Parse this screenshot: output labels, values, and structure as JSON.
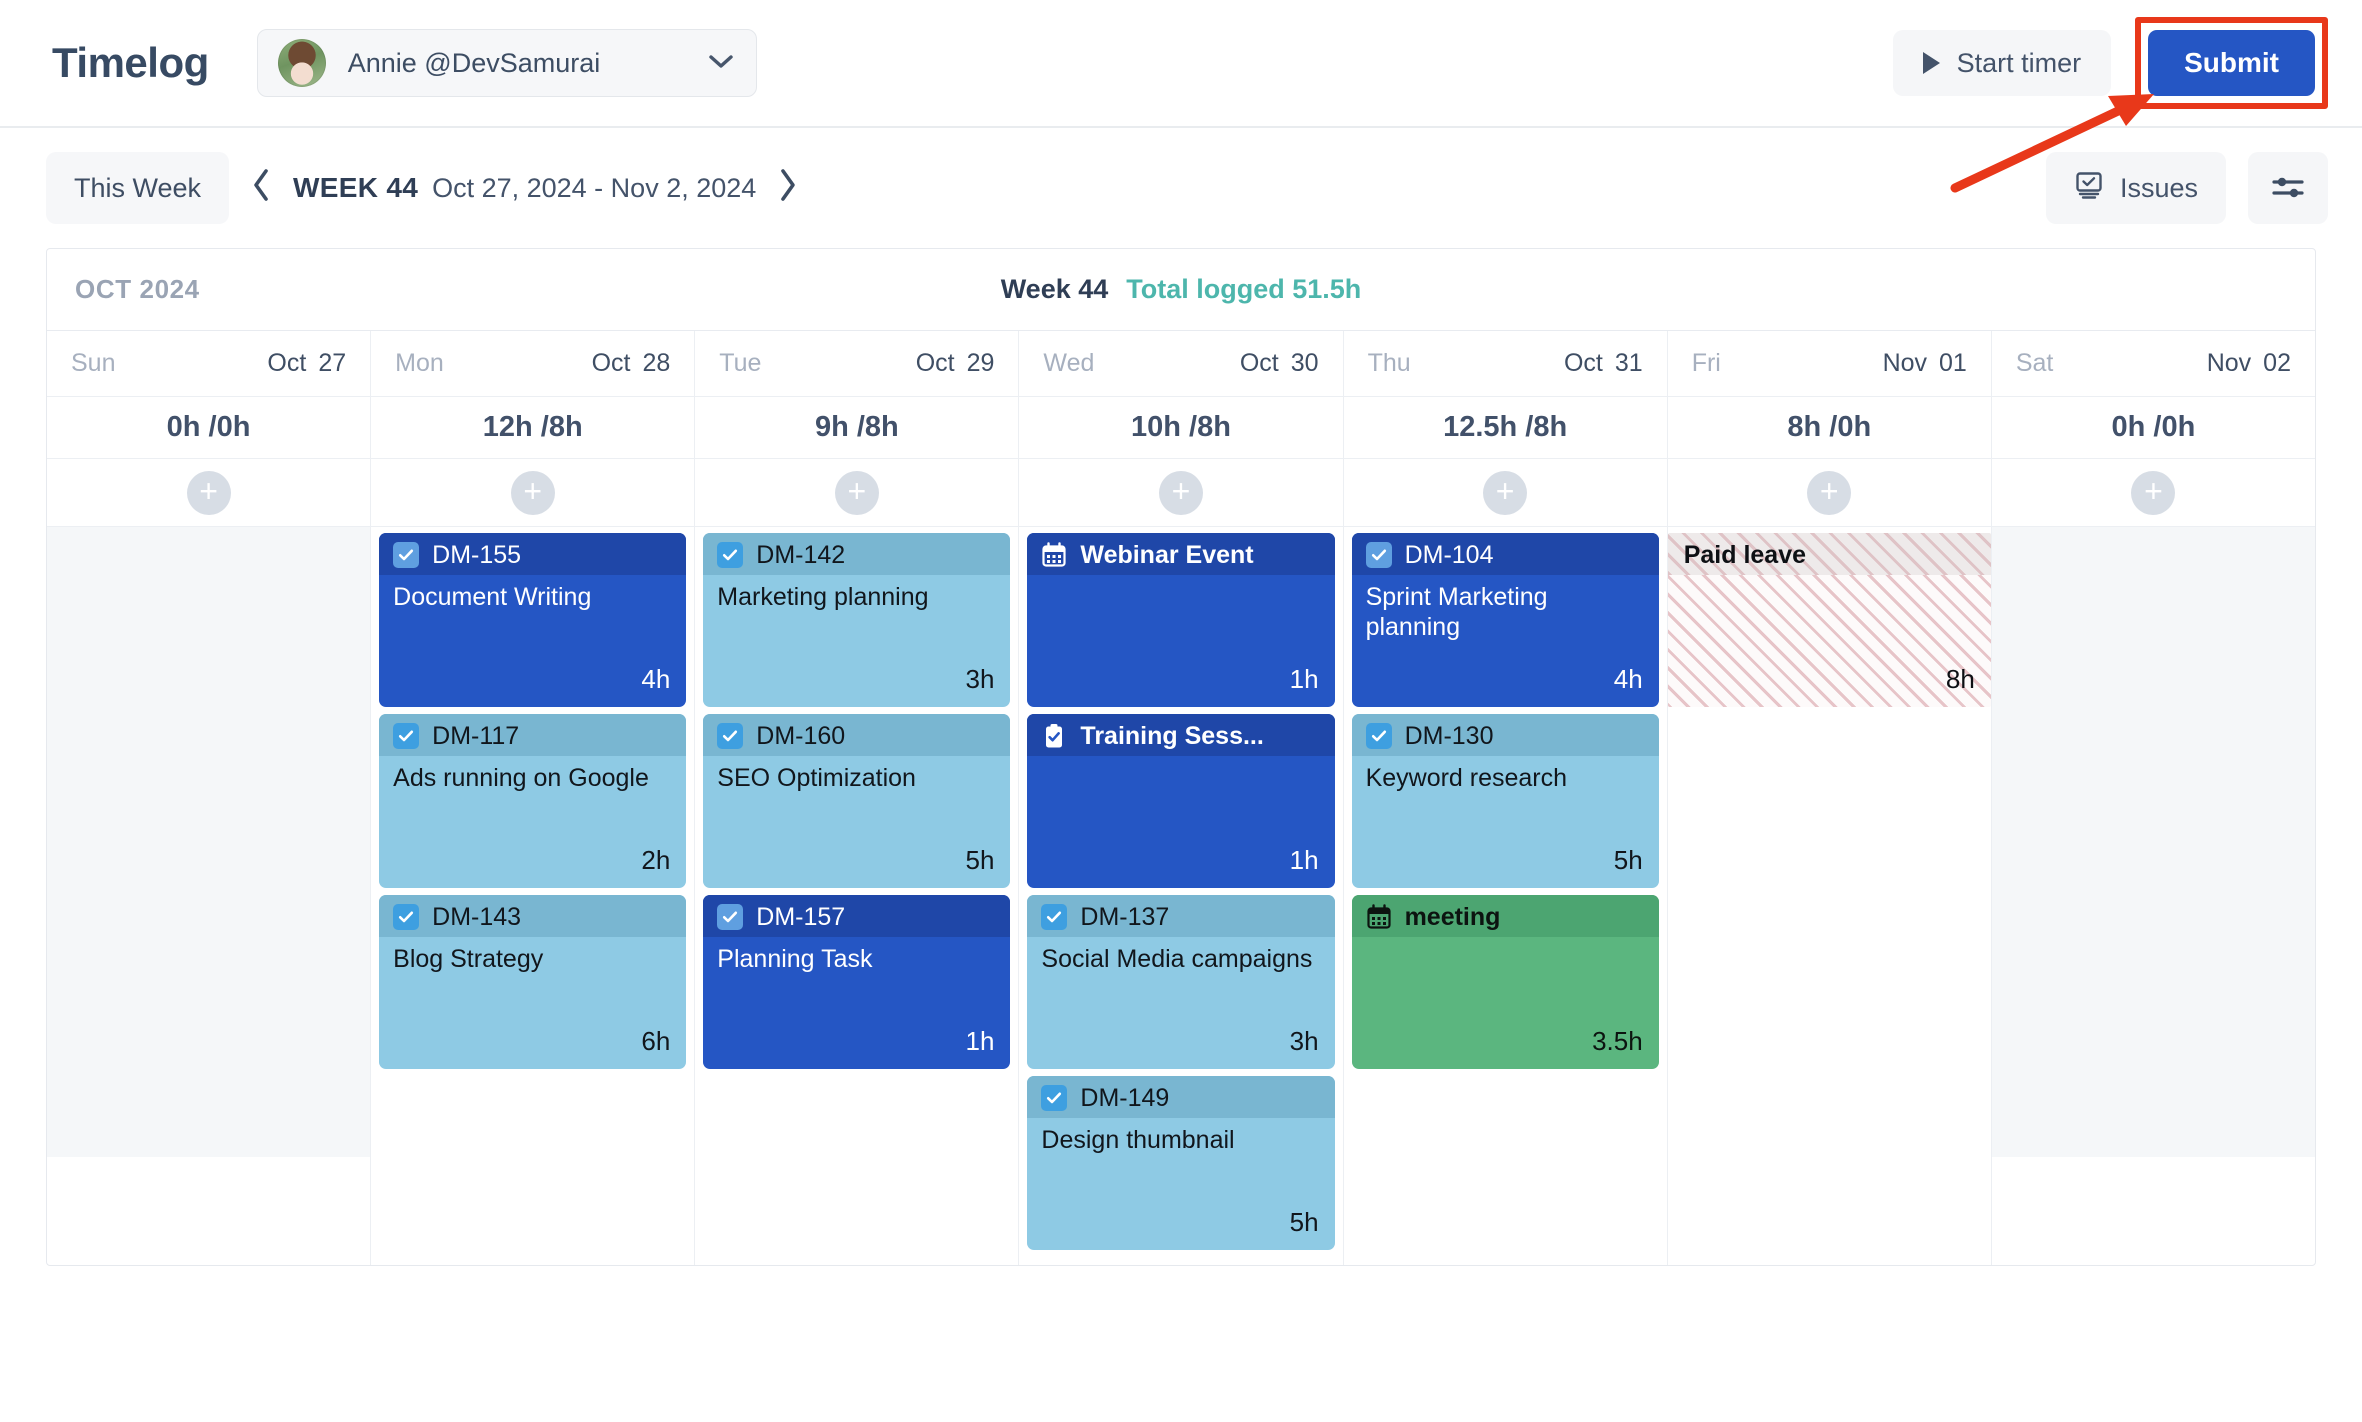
{
  "header": {
    "app_title": "Timelog",
    "user_name": "Annie @DevSamurai",
    "caret_icon": "chevron-down-icon",
    "avatar_icon": "user-avatar",
    "start_timer_label": "Start timer",
    "submit_label": "Submit"
  },
  "nav": {
    "this_week_label": "This Week",
    "prev_label": "‹",
    "next_label": "›",
    "week_number": "WEEK 44",
    "week_range": "Oct 27, 2024 - Nov 2, 2024",
    "issues_label": "Issues",
    "filter_icon": "sliders-icon"
  },
  "calendar": {
    "month_label": "OCT 2024",
    "summary_week": "Week 44",
    "summary_total": "Total logged 51.5h",
    "add_label": "+",
    "days": [
      {
        "dow": "Sun",
        "month": "Oct",
        "date": "27",
        "hours": "0h /0h",
        "weekend": true,
        "entries": []
      },
      {
        "dow": "Mon",
        "month": "Oct",
        "date": "28",
        "hours": "12h /8h",
        "weekend": false,
        "entries": [
          {
            "key": "DM-155",
            "summary": "Document Writing",
            "hours": "4h",
            "theme": "blue",
            "icon": "checkbox-checked-icon",
            "bold_key": false
          },
          {
            "key": "DM-117",
            "summary": "Ads running on Google",
            "hours": "2h",
            "theme": "lightblue",
            "icon": "checkbox-checked-icon",
            "bold_key": false
          },
          {
            "key": "DM-143",
            "summary": "Blog Strategy",
            "hours": "6h",
            "theme": "lightblue",
            "icon": "checkbox-checked-icon",
            "bold_key": false
          }
        ]
      },
      {
        "dow": "Tue",
        "month": "Oct",
        "date": "29",
        "hours": "9h /8h",
        "weekend": false,
        "entries": [
          {
            "key": "DM-142",
            "summary": "Marketing planning",
            "hours": "3h",
            "theme": "lightblue",
            "icon": "checkbox-checked-icon",
            "bold_key": false
          },
          {
            "key": "DM-160",
            "summary": "SEO Optimization",
            "hours": "5h",
            "theme": "lightblue",
            "icon": "checkbox-checked-icon",
            "bold_key": false
          },
          {
            "key": "DM-157",
            "summary": "Planning Task",
            "hours": "1h",
            "theme": "blue",
            "icon": "checkbox-checked-icon",
            "bold_key": false
          }
        ]
      },
      {
        "dow": "Wed",
        "month": "Oct",
        "date": "30",
        "hours": "10h /8h",
        "weekend": false,
        "entries": [
          {
            "key": "Webinar Event",
            "summary": "",
            "hours": "1h",
            "theme": "blue",
            "icon": "calendar-icon",
            "bold_key": true
          },
          {
            "key": "Training Sess...",
            "summary": "",
            "hours": "1h",
            "theme": "blue",
            "icon": "clipboard-check-icon",
            "bold_key": true
          },
          {
            "key": "DM-137",
            "summary": "Social Media campaigns",
            "hours": "3h",
            "theme": "lightblue",
            "icon": "checkbox-checked-icon",
            "bold_key": false
          },
          {
            "key": "DM-149",
            "summary": "Design thumbnail",
            "hours": "5h",
            "theme": "lightblue",
            "icon": "checkbox-checked-icon",
            "bold_key": false
          }
        ]
      },
      {
        "dow": "Thu",
        "month": "Oct",
        "date": "31",
        "hours": "12.5h /8h",
        "weekend": false,
        "entries": [
          {
            "key": "DM-104",
            "summary": "Sprint Marketing planning",
            "hours": "4h",
            "theme": "blue",
            "icon": "checkbox-checked-icon",
            "bold_key": false
          },
          {
            "key": "DM-130",
            "summary": "Keyword research",
            "hours": "5h",
            "theme": "lightblue",
            "icon": "checkbox-checked-icon",
            "bold_key": false
          },
          {
            "key": "meeting",
            "summary": "",
            "hours": "3.5h",
            "theme": "green",
            "icon": "calendar-icon",
            "bold_key": true
          }
        ]
      },
      {
        "dow": "Fri",
        "month": "Nov",
        "date": "01",
        "hours": "8h /0h",
        "weekend": false,
        "entries": [
          {
            "key": "Paid leave",
            "summary": "",
            "hours": "8h",
            "theme": "leave",
            "icon": "none",
            "bold_key": true
          }
        ]
      },
      {
        "dow": "Sat",
        "month": "Nov",
        "date": "02",
        "hours": "0h /0h",
        "weekend": true,
        "entries": []
      }
    ]
  },
  "annotation": {
    "highlight_color": "#e8381a",
    "target": "submit-button"
  },
  "colors": {
    "accent_blue": "#2556c4",
    "light_blue": "#8ecae4",
    "green": "#5bb67f",
    "teal_total": "#4db6ac",
    "leave_pink": "#e7c4c8"
  }
}
